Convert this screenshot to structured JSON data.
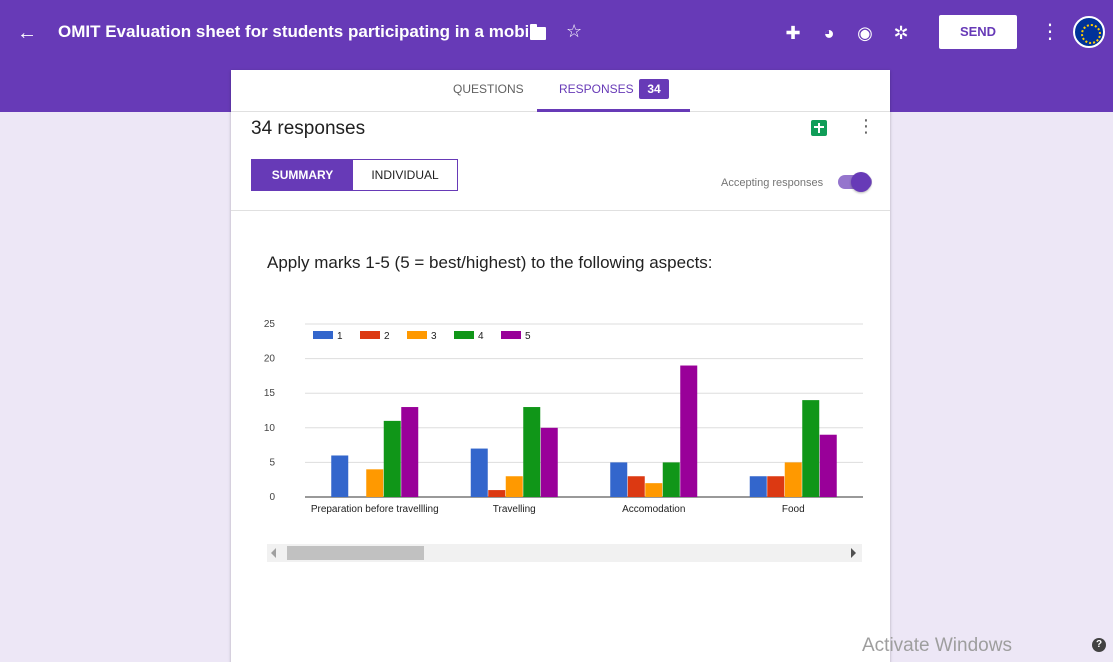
{
  "header": {
    "back_icon": "arrow-left-icon",
    "back_glyph": "←",
    "title": "OMIT Evaluation sheet for students participating in a mobility",
    "star_glyph": "☆",
    "tools": [
      {
        "name": "addon-icon",
        "glyph": "✚"
      },
      {
        "name": "palette-icon",
        "glyph": "◕"
      },
      {
        "name": "preview-icon",
        "glyph": "◉"
      },
      {
        "name": "settings-icon",
        "glyph": "✲"
      }
    ],
    "send_label": "SEND",
    "more_glyph": "⋮",
    "brand_color": "#673ab7"
  },
  "tabs": {
    "questions_label": "QUESTIONS",
    "responses_label": "RESPONSES",
    "responses_count": "34"
  },
  "responses": {
    "title": "34 responses",
    "more_glyph": "⋮",
    "summary_label": "SUMMARY",
    "individual_label": "INDIVIDUAL",
    "accepting_label": "Accepting responses",
    "accepting_on": true
  },
  "question": {
    "text": "Apply marks 1-5 (5 = best/highest) to the following aspects:"
  },
  "chart_data": {
    "type": "bar",
    "categories": [
      "Preparation before travellling",
      "Travelling",
      "Accomodation",
      "Food"
    ],
    "series": [
      {
        "name": "1",
        "color": "#3366cc",
        "values": [
          6,
          7,
          5,
          3
        ]
      },
      {
        "name": "2",
        "color": "#dc3912",
        "values": [
          0,
          1,
          3,
          3
        ]
      },
      {
        "name": "3",
        "color": "#ff9900",
        "values": [
          4,
          3,
          2,
          5
        ]
      },
      {
        "name": "4",
        "color": "#109618",
        "values": [
          11,
          13,
          5,
          14
        ]
      },
      {
        "name": "5",
        "color": "#990099",
        "values": [
          13,
          10,
          19,
          9
        ]
      }
    ],
    "yticks": [
      0,
      5,
      10,
      15,
      20,
      25
    ],
    "ylim": [
      0,
      25
    ],
    "legend": "top-left",
    "grid": true
  },
  "watermark": {
    "text": "Activate Windows",
    "help_glyph": "?"
  }
}
